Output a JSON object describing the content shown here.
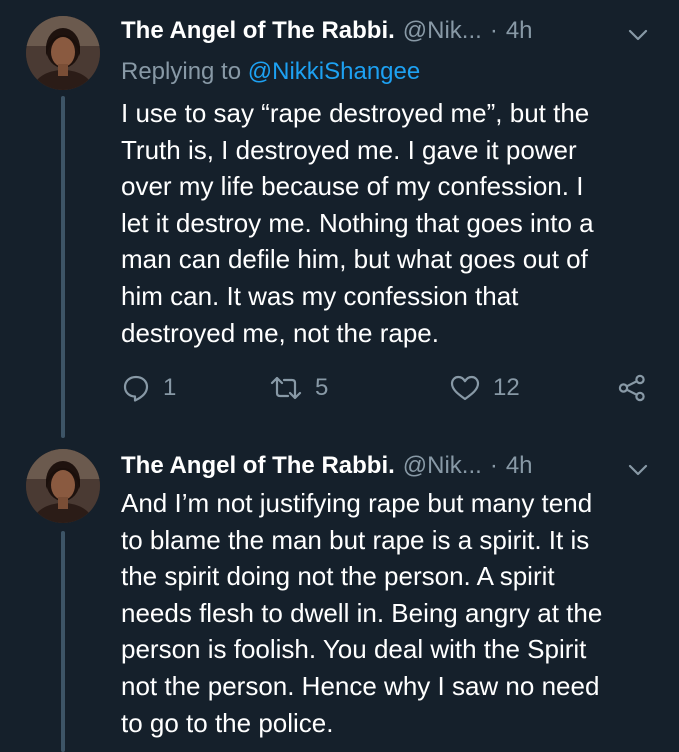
{
  "tweets": [
    {
      "display_name": "The Angel of The Rabbi.",
      "handle": "@Nik...",
      "separator": "·",
      "time": "4h",
      "replying_prefix": "Replying to ",
      "replying_to": "@NikkiShangee",
      "body_lines": [
        "I use to say “rape destroyed me”, but the",
        "Truth is, I destroyed me. I gave it power",
        "over my life because of my confession. I",
        "let it destroy me. Nothing that goes into a",
        "man can defile him, but what goes out of",
        "him can. It was my confession that",
        "destroyed me, not the rape."
      ],
      "actions": {
        "reply_count": "1",
        "retweet_count": "5",
        "like_count": "12"
      }
    },
    {
      "display_name": "The Angel of The Rabbi.",
      "handle": "@Nik...",
      "separator": "·",
      "time": "4h",
      "body_lines": [
        "And I’m not justifying rape but many tend",
        "to blame the man but rape is a spirit. It is",
        "the spirit doing not the person. A spirit",
        "needs flesh to dwell in. Being angry at the",
        "person is foolish. You deal with the Spirit",
        "not the person. Hence why I saw no need",
        "to go to the police."
      ]
    }
  ],
  "icons": {
    "caret": "chevron-down-icon",
    "reply": "reply-bubble-icon",
    "retweet": "retweet-icon",
    "like": "heart-icon",
    "share": "share-icon"
  },
  "colors": {
    "background": "#15202b",
    "secondary_text": "#8899a6",
    "link": "#1da1f2",
    "thread_line": "#3d5466"
  }
}
